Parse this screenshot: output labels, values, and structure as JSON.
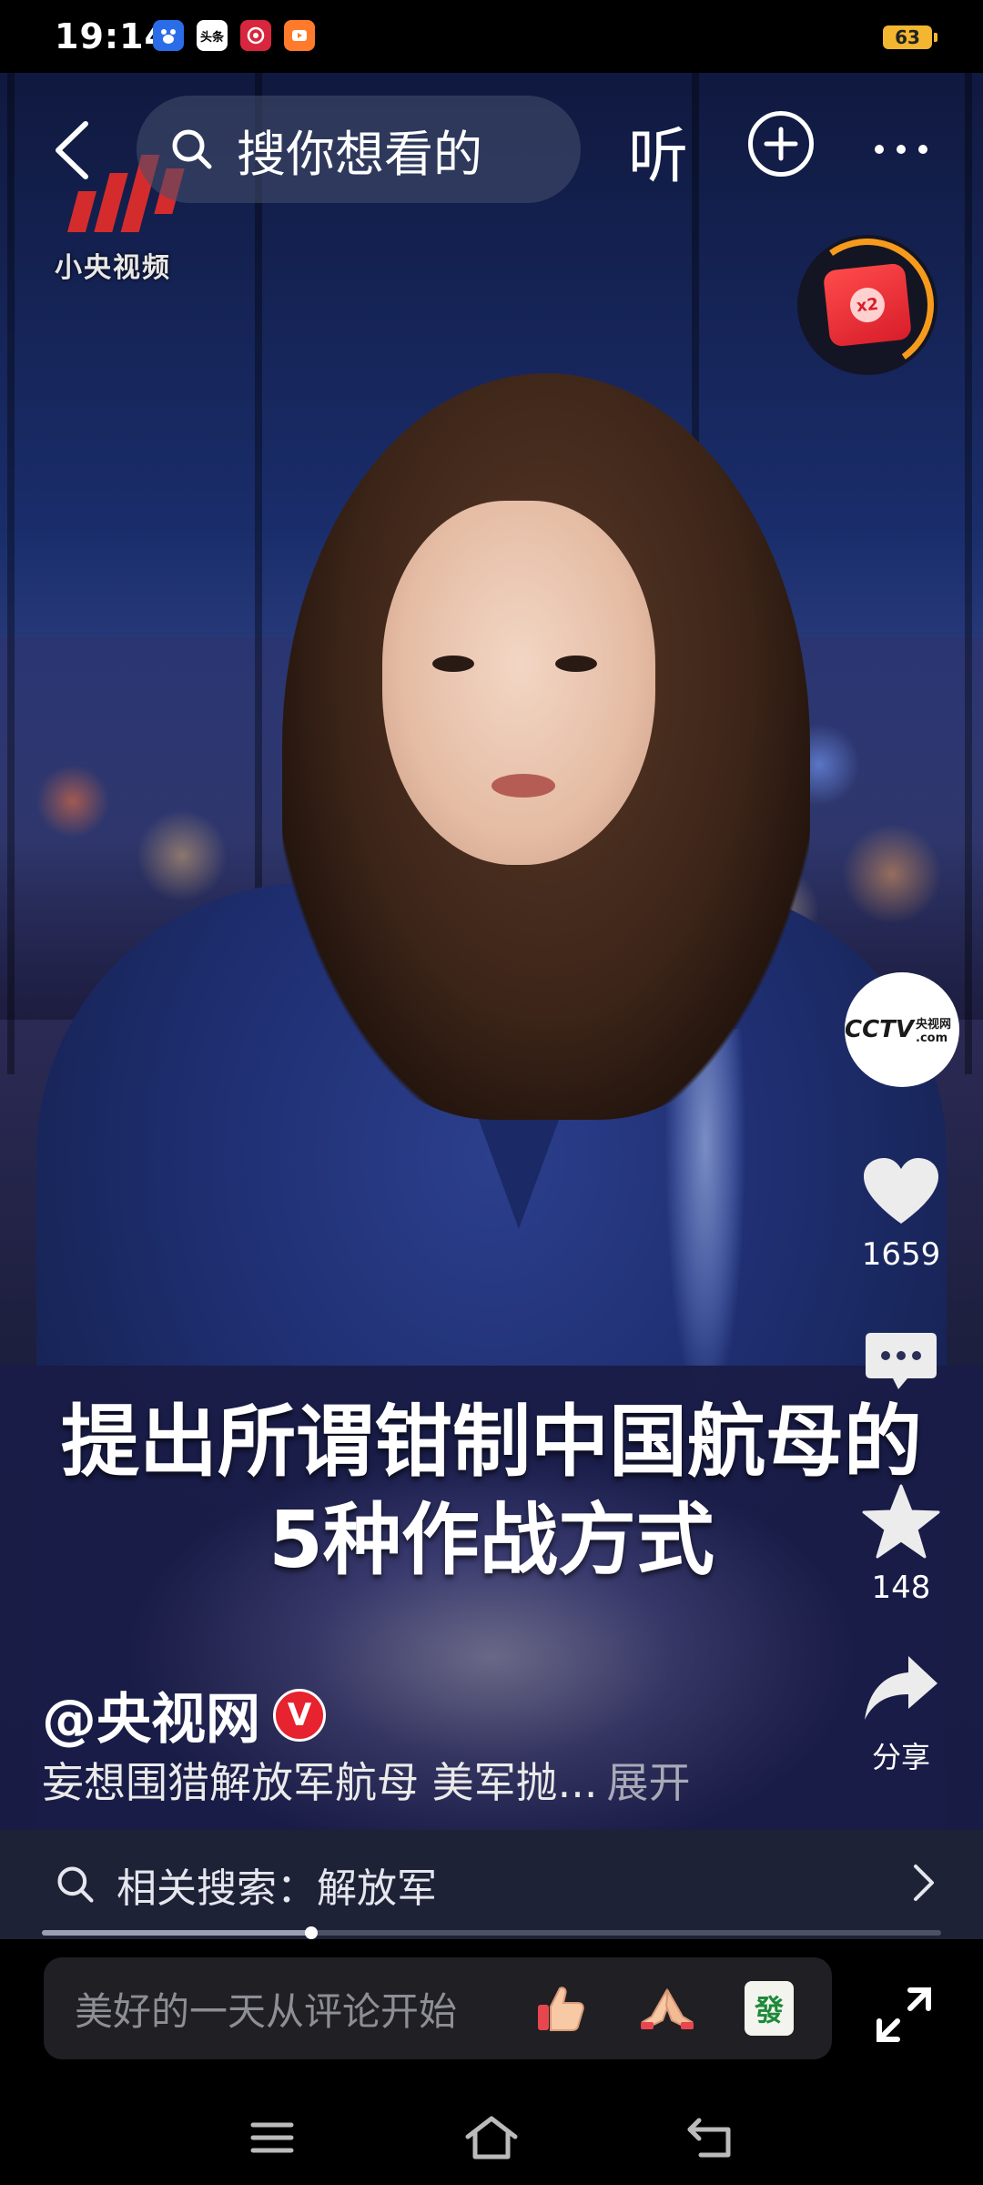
{
  "status_bar": {
    "time": "19:14",
    "battery": "63",
    "app_icons": [
      "baidu-icon",
      "toutiao-icon",
      "netease-icon",
      "video-app-icon"
    ],
    "toutiao_label": "头条"
  },
  "top_nav": {
    "search_placeholder": "搜你想看的",
    "listen_label": "听"
  },
  "watermark": {
    "logo_text": "小央视频"
  },
  "red_packet": {
    "badge": "x2"
  },
  "sidebar": {
    "avatar_text": "CCTV",
    "avatar_suffix": "央视网 .com",
    "like_count": "1659",
    "favorite_count": "148",
    "share_label": "分享"
  },
  "video": {
    "caption_line1": "提出所谓钳制中国航母的",
    "caption_line2": "5种作战方式"
  },
  "post": {
    "author": "@央视网",
    "verified_mark": "V",
    "description": "妄想围猎解放军航母 美军抛...",
    "expand_label": "展开"
  },
  "related_search": {
    "label": "相关搜索：解放军"
  },
  "playback": {
    "progress": 0.3
  },
  "comment_bar": {
    "placeholder": "美好的一天从评论开始",
    "emoji_tile": "發"
  },
  "colors": {
    "accent_red": "#e6232e",
    "ring_orange": "#f79a1c"
  }
}
